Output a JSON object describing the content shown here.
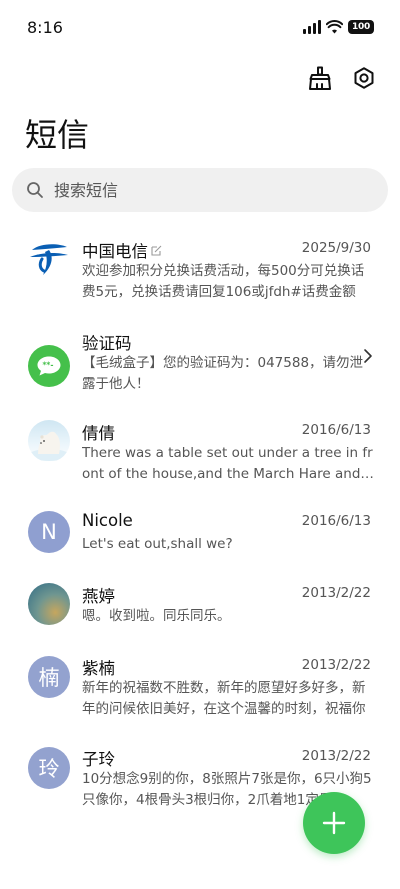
{
  "status_bar": {
    "time": "8:16",
    "battery": "100"
  },
  "header": {
    "title": "短信"
  },
  "search": {
    "placeholder": "搜索短信"
  },
  "conversations": [
    {
      "name": "中国电信",
      "date": "2025/9/30",
      "preview": "欢迎参加积分兑换话费活动，每500分可兑换话费5元，兑换话费请回复106或jfdh#话费金额"
    },
    {
      "name": "验证码",
      "date": "",
      "preview": "【毛绒盒子】您的验证码为：047588，请勿泄露于他人！"
    },
    {
      "name": "倩倩",
      "date": "2016/6/13",
      "preview": "There was a table set out under a tree in front of the house,and the March Hare and the Hatter"
    },
    {
      "name": "Nicole",
      "date": "2016/6/13",
      "preview": "Let's eat out,shall we?",
      "initial": "N"
    },
    {
      "name": "燕婷",
      "date": "2013/2/22",
      "preview": "嗯。收到啦。同乐同乐。"
    },
    {
      "name": "紫楠",
      "date": "2013/2/22",
      "preview": "新年的祝福数不胜数，新年的愿望好多好多，新年的问候依旧美好，在这个温馨的时刻，祝福你"
    },
    {
      "name": "子玲",
      "date": "2013/2/22",
      "preview": "10分想念9别的你，8张照片7张是你，6只小狗5只像你，4根骨头3根归你，2爪着地1定是你"
    }
  ],
  "avatar_initials": {
    "zinan": "楠",
    "ziling": "玲"
  },
  "colors": {
    "accent": "#3ec55a",
    "telecom_blue": "#0a5fb4",
    "chat_green": "#45c04b"
  }
}
